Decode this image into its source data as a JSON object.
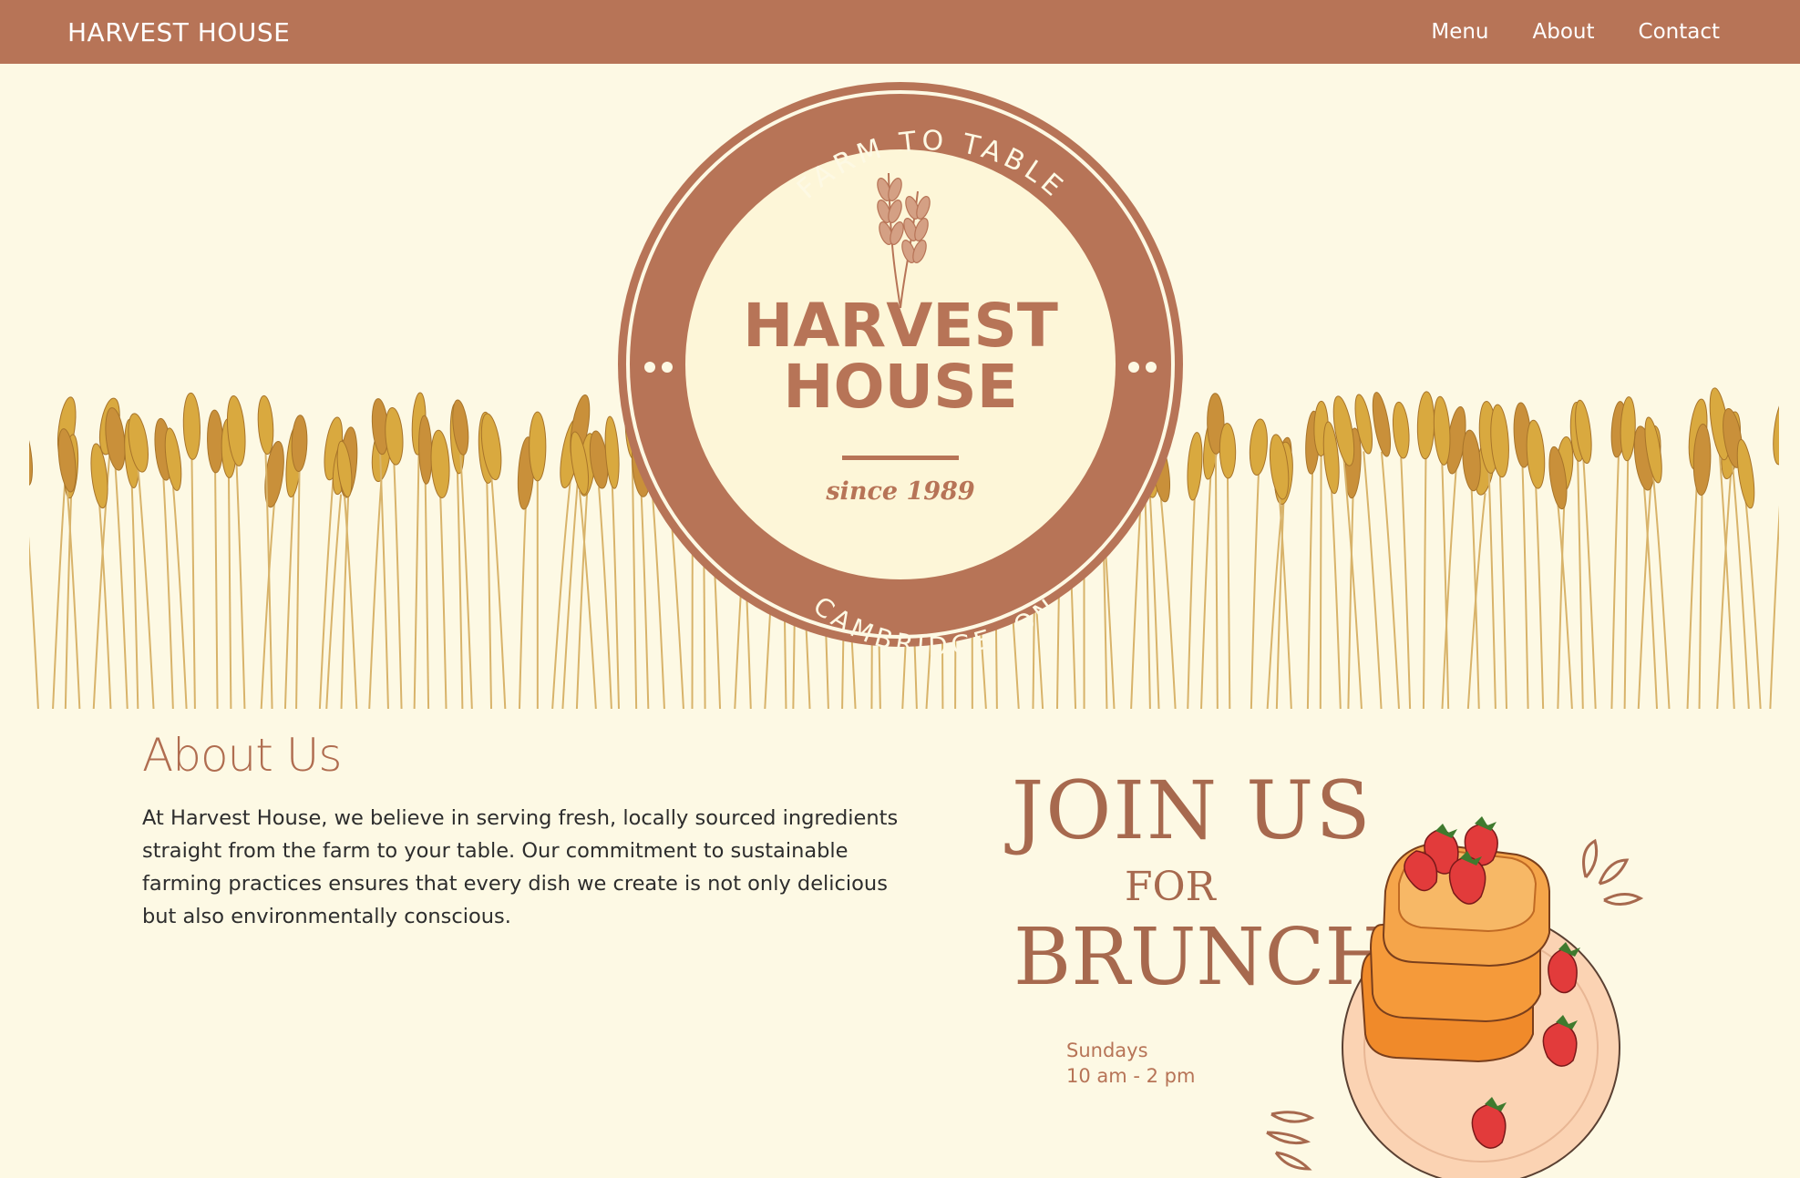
{
  "navbar": {
    "brand": "HARVEST HOUSE",
    "links": [
      "Menu",
      "About",
      "Contact"
    ]
  },
  "hero_badge": {
    "top_text": "FARM TO TABLE",
    "name_line1": "HARVEST",
    "name_line2": "HOUSE",
    "since": "since 1989",
    "bottom_text": "CAMBRIDGE, ON"
  },
  "about": {
    "title": "About Us",
    "body": "At Harvest House, we believe in serving fresh, locally sourced ingredients straight from the farm to your table. Our commitment to sustainable farming practices ensures that every dish we create is not only delicious but also environmentally conscious."
  },
  "brunch": {
    "line1": "JOIN US",
    "line2": "FOR",
    "line3": "BRUNCH",
    "day": "Sundays",
    "hours": "10 am - 2 pm"
  },
  "colors": {
    "accent": "#b77457",
    "background": "#fdf9e4",
    "wheat": "#d9a93f"
  }
}
